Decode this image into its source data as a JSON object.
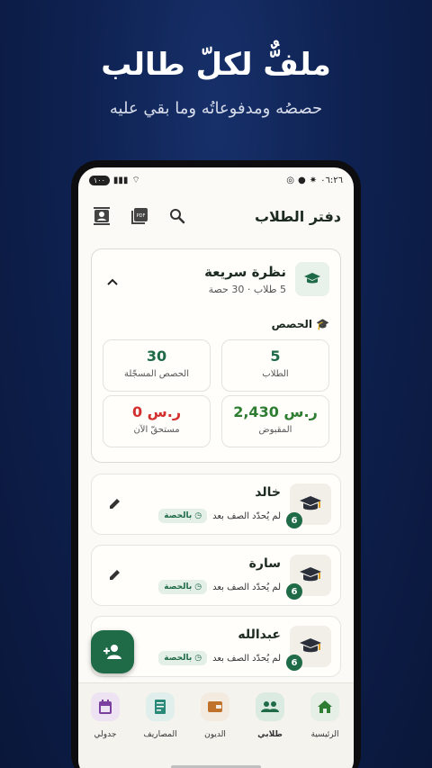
{
  "hero": {
    "title": "ملفٌّ لكلّ طالب",
    "subtitle": "حصصُه ومدفوعاتُه وما بقي عليه"
  },
  "status_bar": {
    "time": "٠٦:٢٦",
    "battery": "١٠٠"
  },
  "app_bar": {
    "title": "دفتر الطلاب",
    "icons": [
      "contact-icon",
      "pdf-icon",
      "search-icon"
    ]
  },
  "summary": {
    "title": "نظرة سريعة",
    "meta": "5 طلاب · 30 حصة",
    "section_label": "الحصص",
    "stats": [
      {
        "value": "5",
        "label": "الطلاب",
        "color": "#1f6b47"
      },
      {
        "value": "30",
        "label": "الحصص المسجّلة",
        "color": "#1f6b47"
      },
      {
        "value": "2,430 ر.س",
        "label": "المقبوض",
        "color": "#2e7d32"
      },
      {
        "value": "0 ر.س",
        "label": "مستحقّ الآن",
        "color": "#d32f2f"
      }
    ]
  },
  "students": [
    {
      "name": "خالد",
      "status": "لم يُحدّد الصف بعد",
      "badge": "بالحصة",
      "count": "6"
    },
    {
      "name": "سارة",
      "status": "لم يُحدّد الصف بعد",
      "badge": "بالحصة",
      "count": "6"
    },
    {
      "name": "عبدالله",
      "status": "لم يُحدّد الصف بعد",
      "badge": "بالحصة",
      "count": "6"
    }
  ],
  "nav": [
    {
      "label": "الرئيسية",
      "icon": "home-icon",
      "color": "#2e7d32"
    },
    {
      "label": "طلابي",
      "icon": "people-icon",
      "color": "#1f6b47",
      "active": true
    },
    {
      "label": "الديون",
      "icon": "wallet-icon",
      "color": "#c0722a"
    },
    {
      "label": "المصاريف",
      "icon": "receipt-icon",
      "color": "#2a8a7a"
    },
    {
      "label": "جدولي",
      "icon": "calendar-icon",
      "color": "#7b3fa0"
    }
  ]
}
